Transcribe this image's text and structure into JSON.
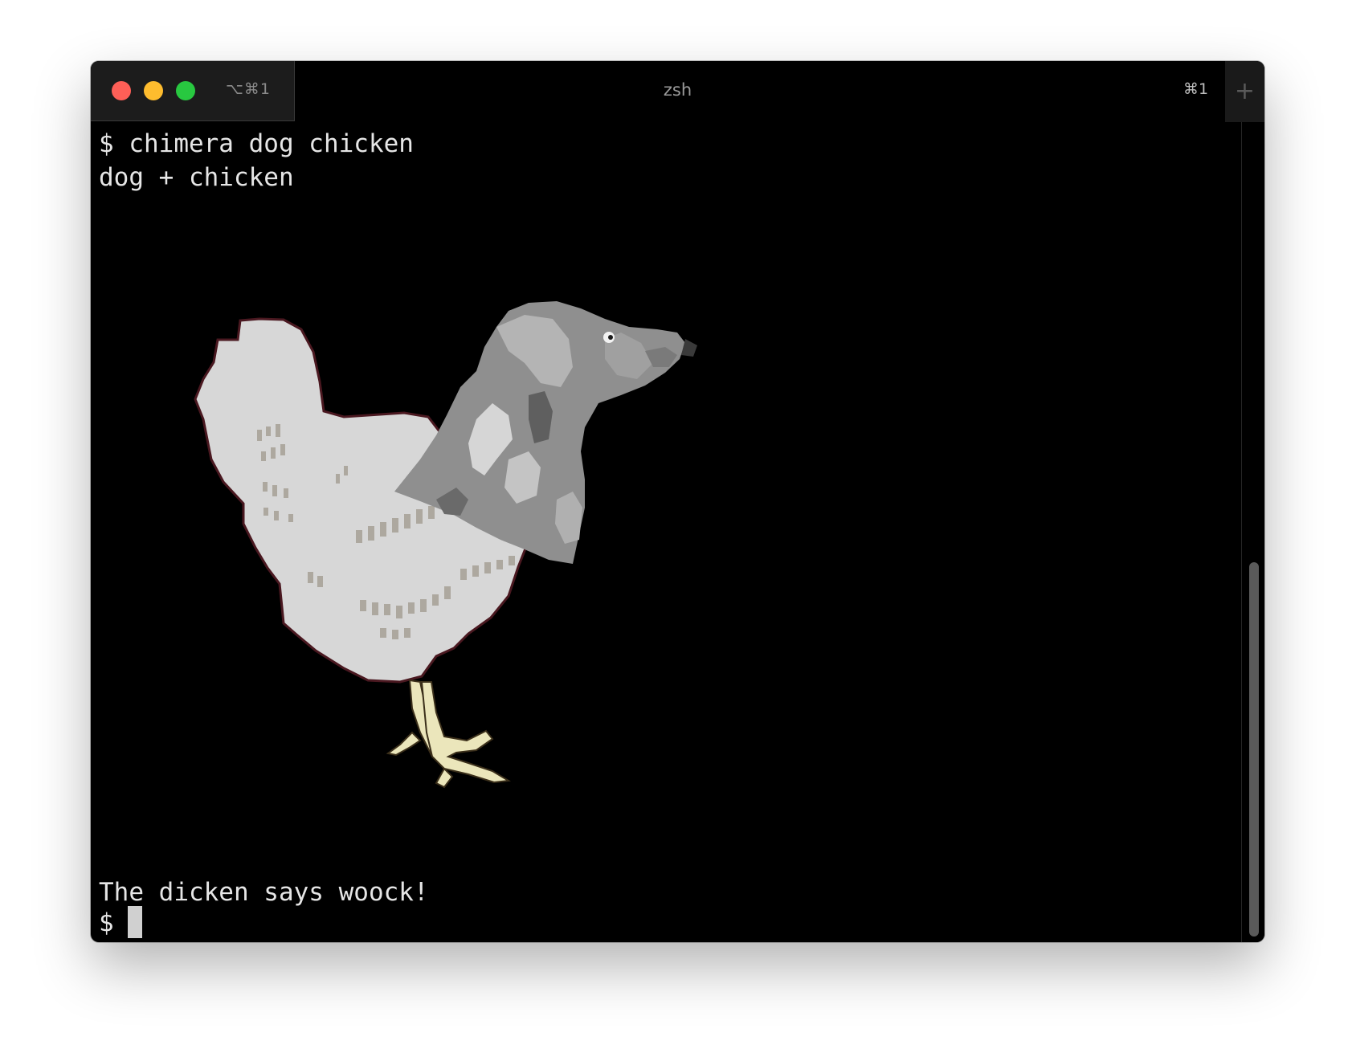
{
  "window": {
    "title": "zsh",
    "tab_shortcut": "⌥⌘1",
    "right_shortcut": "⌘1",
    "new_tab_label": "+"
  },
  "traffic_lights": {
    "close_color": "#fe5f57",
    "minimize_color": "#febc2e",
    "maximize_color": "#28c840"
  },
  "terminal": {
    "prompt_command": "$ chimera dog chicken",
    "output_title": "dog + chicken",
    "output_caption": "The dicken says woock!",
    "prompt": "$ "
  },
  "scrollbar": {
    "thumb_color": "#5a5a5a"
  }
}
